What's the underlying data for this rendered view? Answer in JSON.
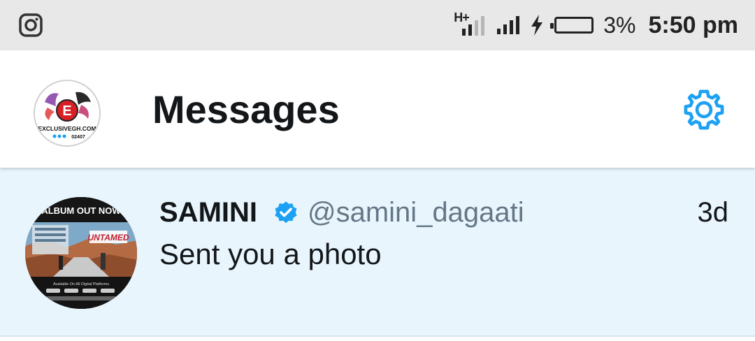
{
  "status_bar": {
    "network_type": "H+",
    "battery_percent": "3%",
    "time": "5:50 pm",
    "icons": [
      "instagram-icon",
      "hplus-signal-icon",
      "signal-icon",
      "charging-icon",
      "battery-icon"
    ]
  },
  "header": {
    "title": "Messages",
    "profile_logo_text": "EXCLUSIVEGH.COM",
    "profile_logo_sub": "02407"
  },
  "conversations": [
    {
      "name": "SAMINI",
      "handle": "@samini_dagaati",
      "time": "3d",
      "preview": "Sent you a photo",
      "verified": true,
      "avatar_text_top": "ALBUM OUT NOW",
      "avatar_text_mid": "UNTAMED",
      "avatar_text_bottom": "Available On All Digital Platforms"
    }
  ],
  "colors": {
    "status_bg": "#e8e8e8",
    "accent": "#1da1f2",
    "row_bg": "#e8f5fd",
    "text": "#14171a",
    "handle": "#657786"
  }
}
